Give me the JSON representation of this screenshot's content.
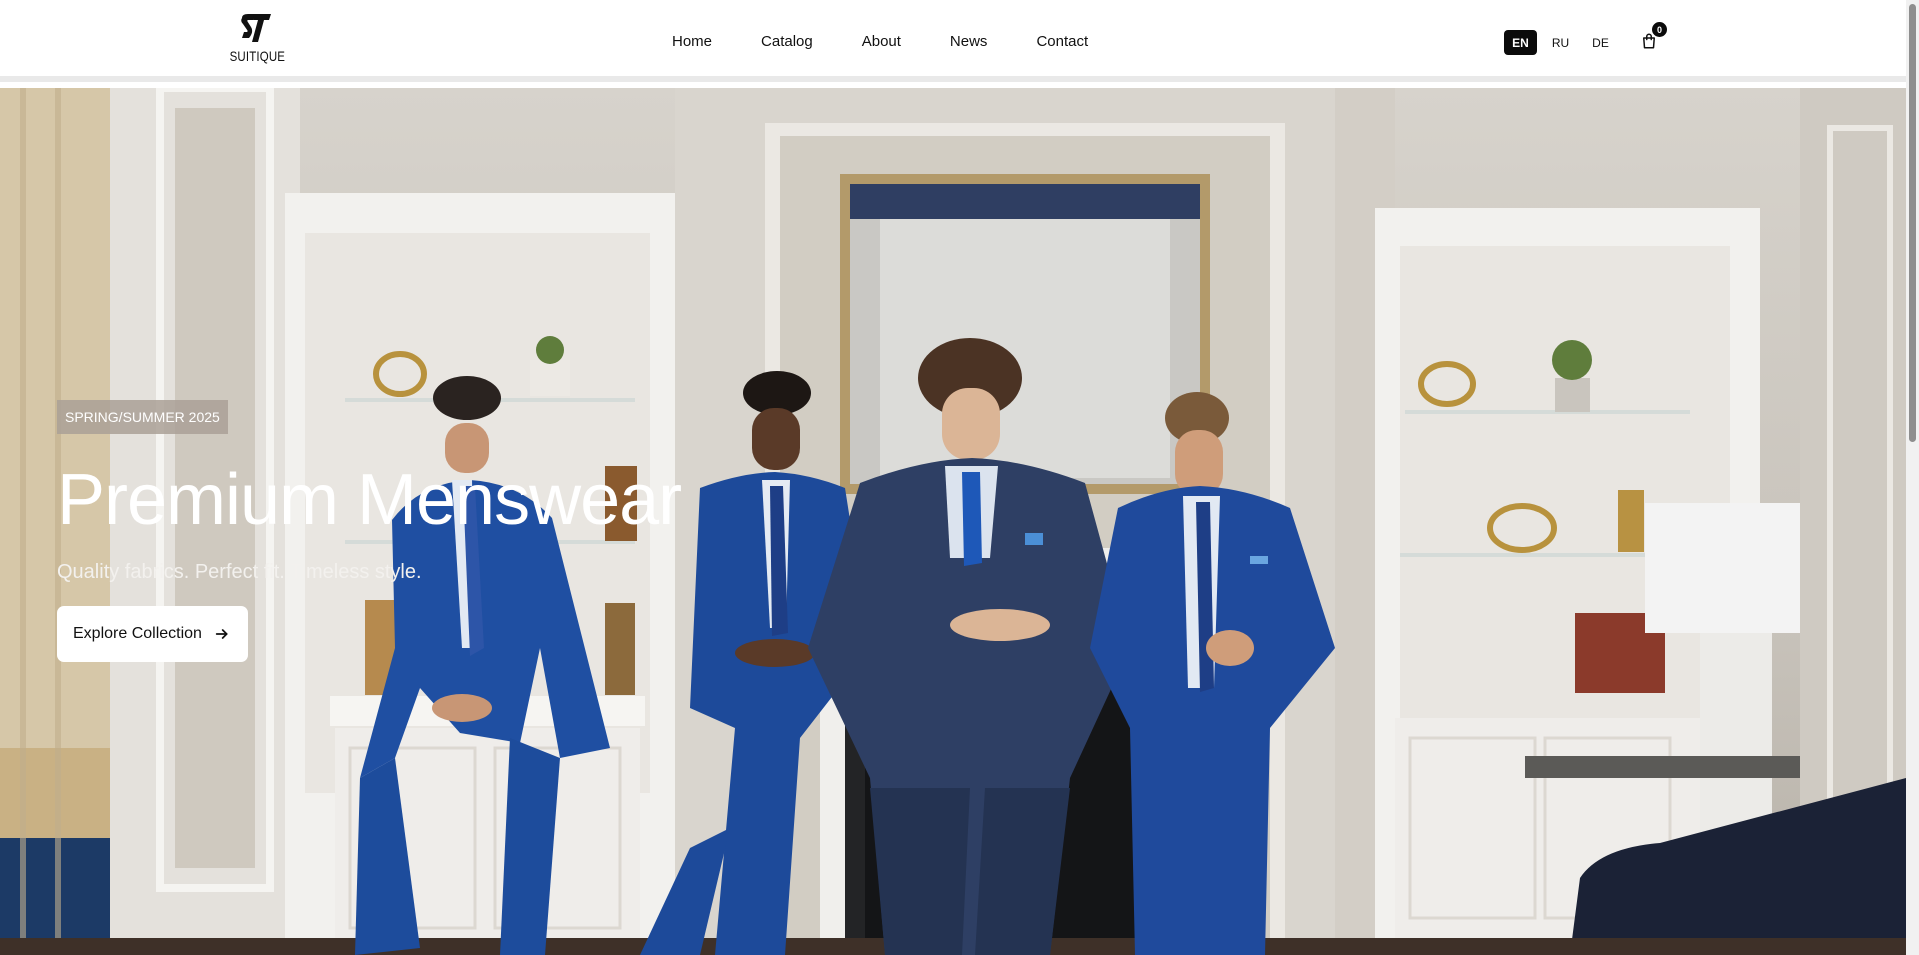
{
  "brand": {
    "name": "SUITIQUE",
    "mark": "ST"
  },
  "nav": [
    {
      "label": "Home"
    },
    {
      "label": "Catalog"
    },
    {
      "label": "About"
    },
    {
      "label": "News"
    },
    {
      "label": "Contact"
    }
  ],
  "languages": [
    {
      "code": "EN",
      "active": true
    },
    {
      "code": "RU",
      "active": false
    },
    {
      "code": "DE",
      "active": false
    }
  ],
  "cart": {
    "count": "0",
    "icon": "shopping-bag-icon"
  },
  "hero": {
    "badge": "SPRING/SUMMER 2025",
    "title": "Premium Menswear",
    "subtitle": "Quality fabrics. Perfect fit. Timeless style.",
    "cta_label": "Explore Collection",
    "cta_icon": "arrow-right-icon"
  },
  "colors": {
    "accent": "#0b0b0b",
    "suit_blue": "#1f4b99",
    "wall": "#d4d0c9"
  }
}
